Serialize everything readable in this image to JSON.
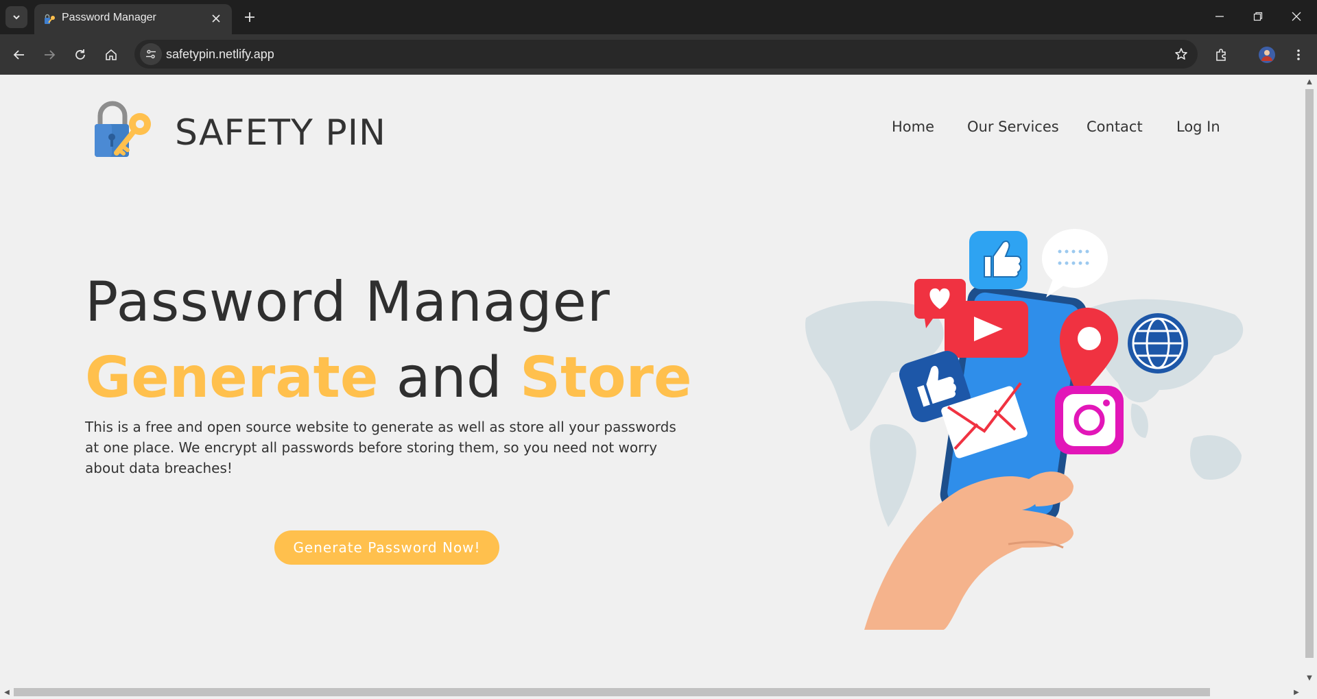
{
  "browser": {
    "tab_title": "Password Manager",
    "url": "safetypin.netlify.app"
  },
  "site": {
    "brand": "SAFETY PIN",
    "nav": [
      "Home",
      "Our Services",
      "Contact",
      "Log In"
    ]
  },
  "hero": {
    "title": "Password Manager",
    "subtitle_word1": "Generate",
    "subtitle_word2": "and",
    "subtitle_word3": "Store",
    "description": "This is a free and open source website to generate as well as store all your passwords at one place. We encrypt all passwords before storing them, so you need not worry about data breaches!",
    "cta_label": "Generate Password Now!"
  },
  "colors": {
    "accent": "#ffc04d",
    "text": "#333333",
    "background": "#f0f0f0",
    "browser_dark": "#1f1f1f",
    "toolbar": "#353535"
  },
  "icons": {
    "illustration": [
      "thumbs-up-icon",
      "chat-bubble-icon",
      "heart-icon",
      "play-icon",
      "location-pin-icon",
      "globe-icon",
      "like-icon",
      "mail-icon",
      "camera-icon"
    ]
  }
}
